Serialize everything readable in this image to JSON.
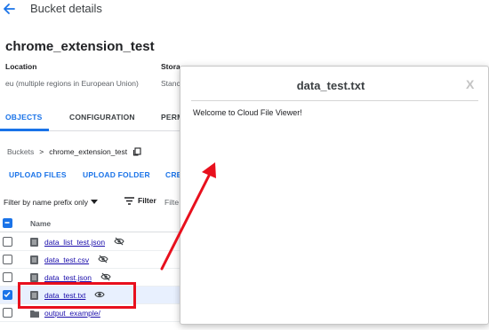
{
  "header": {
    "title": "Bucket details",
    "back_icon": "arrow-left-icon"
  },
  "bucket": {
    "name": "chrome_extension_test"
  },
  "meta": {
    "location_label": "Location",
    "location_value": "eu (multiple regions in European Union)",
    "storage_label": "Stora",
    "storage_value": "Stanc"
  },
  "tabs": [
    {
      "label": "OBJECTS",
      "active": true
    },
    {
      "label": "CONFIGURATION",
      "active": false
    },
    {
      "label": "PERM",
      "active": false
    }
  ],
  "breadcrumb": {
    "root": "Buckets",
    "separator": ">",
    "current": "chrome_extension_test"
  },
  "actions": {
    "upload_files": "UPLOAD FILES",
    "upload_folder": "UPLOAD FOLDER",
    "create": "CRE"
  },
  "filter": {
    "prefix_label": "Filter by name prefix only",
    "filter_label": "Filter",
    "placeholder": "Filte"
  },
  "table": {
    "column_name": "Name",
    "rows": [
      {
        "name": "data_list_test.json",
        "visibility": "eye-off-icon",
        "selected": false
      },
      {
        "name": "data_test.csv",
        "visibility": "eye-off-icon",
        "selected": false
      },
      {
        "name": "data_test.json",
        "visibility": "eye-off-icon",
        "selected": false
      },
      {
        "name": "data_test.txt",
        "visibility": "eye-icon",
        "selected": true
      },
      {
        "name": "output_example/",
        "visibility": "",
        "selected": false
      }
    ]
  },
  "viewer": {
    "title": "data_test.txt",
    "close": "X",
    "body": "Welcome to Cloud File Viewer!"
  },
  "colors": {
    "accent": "#1a73e8",
    "annotation": "#e8101d",
    "link": "#1a0dab"
  }
}
